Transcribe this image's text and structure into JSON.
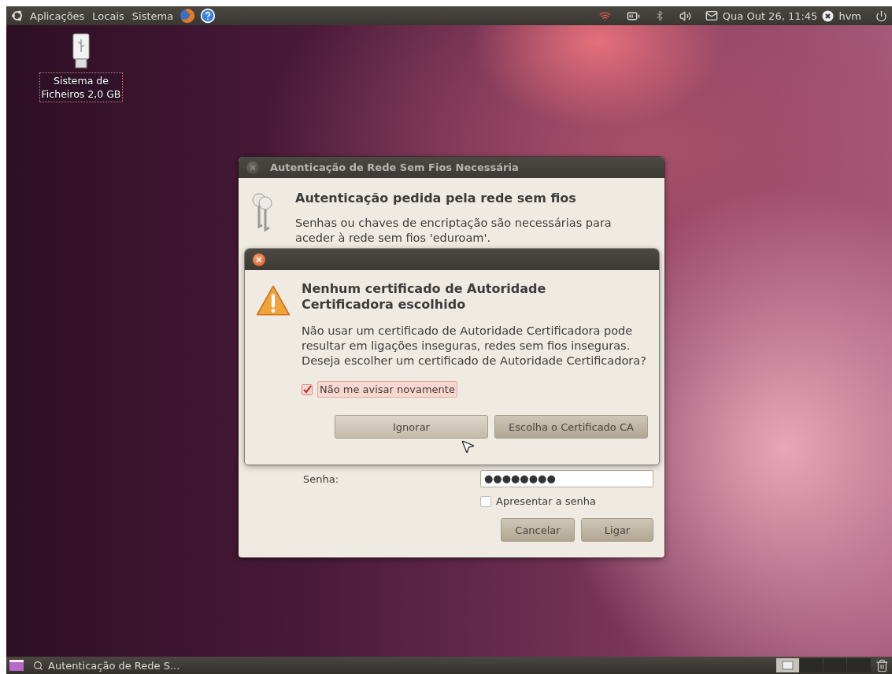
{
  "top_panel": {
    "menus": [
      "Aplicações",
      "Locais",
      "Sistema"
    ],
    "clock": "Qua Out 26, 11:45",
    "user": "hvm"
  },
  "desktop_icons": [
    {
      "lines": [
        "Sistema de",
        "Ficheiros 2,0 GB"
      ],
      "selected": true
    }
  ],
  "auth_dialog": {
    "title": "Autenticação de Rede Sem Fios Necessária",
    "heading": "Autenticação pedida pela rede sem fios",
    "message": "Senhas ou chaves de encriptação são necessárias para aceder à rede sem fios 'eduroam'.",
    "password_label": "Senha:",
    "password_value": "●●●●●●●●",
    "show_password": {
      "label": "Apresentar a senha",
      "checked": false
    },
    "buttons": [
      "Cancelar",
      "Ligar"
    ]
  },
  "warning_dialog": {
    "heading": "Nenhum certificado de Autoridade Certificadora escolhido",
    "message": "Não usar um certificado de Autoridade Certificadora pode resultar em ligações inseguras, redes sem fios inseguras. Deseja escolher um certificado de Autoridade Certificadora?",
    "checkbox": {
      "label": "Não me avisar novamente",
      "checked": true,
      "focused": true
    },
    "buttons": [
      {
        "label": "Ignorar",
        "hovered": true
      },
      {
        "label": "Escolha o Certificado CA",
        "hovered": false
      }
    ]
  },
  "taskbar": {
    "windows": [
      {
        "label": "Autenticação de Rede S...",
        "selected": false
      }
    ]
  }
}
